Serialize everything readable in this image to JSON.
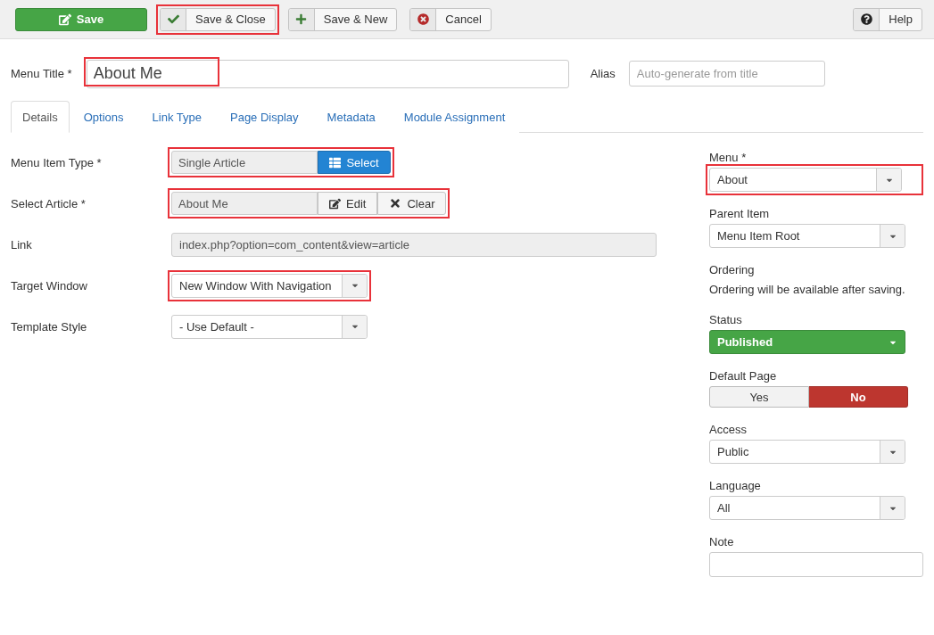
{
  "toolbar": {
    "buttons": [
      {
        "label": "Save",
        "highlighted": false
      },
      {
        "label": "Save & Close",
        "highlighted": true
      },
      {
        "label": "Save & New",
        "highlighted": false
      },
      {
        "label": "Cancel",
        "highlighted": false
      }
    ],
    "help": {
      "label": "Help"
    }
  },
  "title_field": {
    "label": "Menu Title *",
    "value": "About Me",
    "highlighted": true
  },
  "alias_field": {
    "label": "Alias",
    "placeholder": "Auto-generate from title"
  },
  "tabs": [
    {
      "label": "Details",
      "selected": true
    },
    {
      "label": "Options",
      "selected": false
    },
    {
      "label": "Link Type",
      "selected": false
    },
    {
      "label": "Page Display",
      "selected": false
    },
    {
      "label": "Metadata",
      "selected": false
    },
    {
      "label": "Module Assignment",
      "selected": false
    }
  ],
  "main_fields": [
    {
      "kind": "picker",
      "label": "Menu Item Type *",
      "value": "Single Article",
      "highlighted": true,
      "buttons": [
        {
          "label": "Select"
        }
      ]
    },
    {
      "kind": "picker",
      "label": "Select Article *",
      "value": "About Me",
      "highlighted": true,
      "buttons": [
        {
          "label": "Edit"
        },
        {
          "label": "Clear"
        }
      ]
    },
    {
      "kind": "readonly",
      "label": "Link",
      "value": "index.php?option=com_content&view=article"
    },
    {
      "kind": "select",
      "label": "Target Window",
      "value": "New Window With Navigation",
      "highlighted": true
    },
    {
      "kind": "select",
      "label": "Template Style",
      "value": "- Use Default -",
      "highlighted": false
    }
  ],
  "side_fields": [
    {
      "kind": "select",
      "label": "Menu *",
      "value": "About",
      "highlighted": true
    },
    {
      "kind": "select",
      "label": "Parent Item",
      "value": "Menu Item Root",
      "highlighted": false
    },
    {
      "kind": "text",
      "label": "Ordering",
      "value": "Ordering will be available after saving."
    },
    {
      "kind": "status",
      "label": "Status",
      "value": "Published"
    },
    {
      "kind": "toggle",
      "label": "Default Page",
      "options": [
        {
          "label": "Yes",
          "selected": false
        },
        {
          "label": "No",
          "selected": true
        }
      ]
    },
    {
      "kind": "select",
      "label": "Access",
      "value": "Public",
      "highlighted": false
    },
    {
      "kind": "select",
      "label": "Language",
      "value": "All",
      "highlighted": false
    },
    {
      "kind": "input",
      "label": "Note"
    }
  ]
}
